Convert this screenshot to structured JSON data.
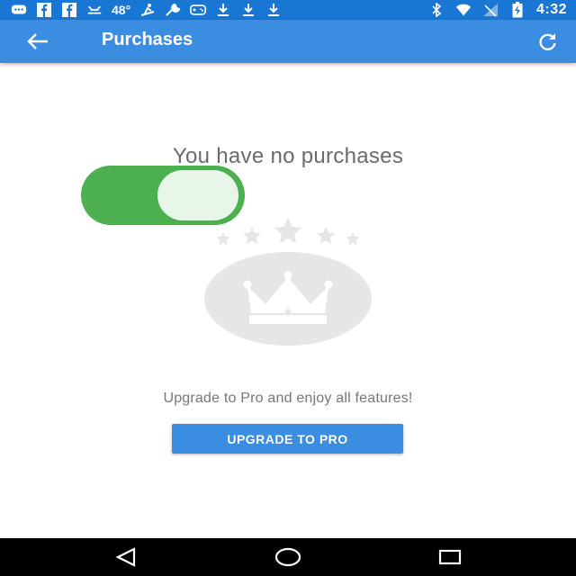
{
  "status_bar": {
    "left_icons": [
      "chat-bubble-icon",
      "facebook-icon",
      "facebook-icon",
      "weather-icon"
    ],
    "temperature": "48°",
    "more_icons": [
      "surf-icon",
      "wrench-icon",
      "gamepad-icon",
      "download-icon",
      "download-icon",
      "download-icon"
    ],
    "right_icons": [
      "bluetooth-icon",
      "wifi-icon",
      "no-signal-icon",
      "battery-charging-icon"
    ],
    "time": "4:32"
  },
  "app_bar": {
    "title": "Purchases",
    "back_icon": "arrow-left-icon",
    "refresh_icon": "refresh-icon"
  },
  "content": {
    "empty_title": "You have no purchases",
    "toggle": {
      "state": "on",
      "color": "#4caf50"
    },
    "upgrade_text": "Upgrade to Pro and enjoy all features!",
    "upgrade_button": "UPGRADE TO PRO"
  },
  "nav_bar": {
    "buttons": [
      "back-triangle-icon",
      "home-circle-icon",
      "recents-square-icon"
    ]
  },
  "colors": {
    "status_bar": "#1976d2",
    "app_bar": "#3a8de0",
    "accent": "#3a8de0",
    "toggle_on": "#4caf50",
    "illustration": "#e6e6e6"
  }
}
